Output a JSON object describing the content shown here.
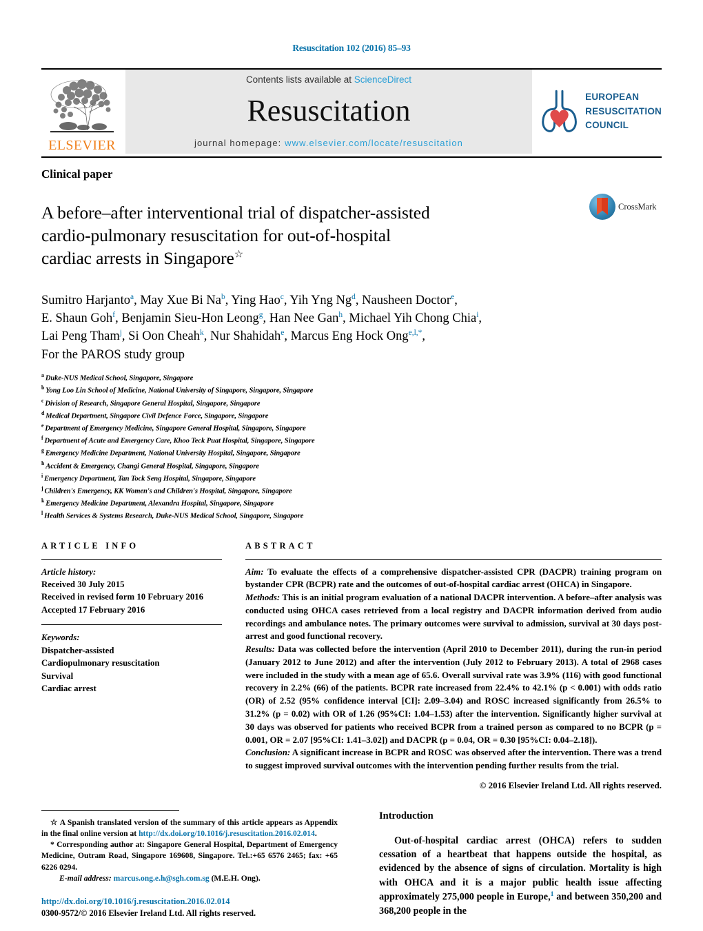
{
  "running_head": "Resuscitation 102 (2016) 85–93",
  "masthead": {
    "elsevier_wordmark": "ELSEVIER",
    "contents_prefix": "Contents lists available at ",
    "contents_link": "ScienceDirect",
    "journal_name": "Resuscitation",
    "homepage_prefix": "journal homepage: ",
    "homepage_url": "www.elsevier.com/locate/resuscitation",
    "erc_lines": [
      "EUROPEAN",
      "RESUSCITATION",
      "COUNCIL"
    ],
    "colors": {
      "elsevier_orange": "#F07F1A",
      "link_blue": "#2a9fd6",
      "erc_blue": "#1a5e8f",
      "erc_heart_red": "#e04a4a",
      "band_grey": "#e8e8e8"
    }
  },
  "section_type": "Clinical paper",
  "title": {
    "line1": "A before–after interventional trial of dispatcher-assisted",
    "line2": "cardio-pulmonary resuscitation for out-of-hospital",
    "line3": "cardiac arrests in Singapore",
    "star": "☆"
  },
  "crossmark": {
    "label": "CrossMark"
  },
  "authors": {
    "line1": [
      {
        "name": "Sumitro Harjanto",
        "sup": "a"
      },
      {
        "name": "May Xue Bi Na",
        "sup": "b"
      },
      {
        "name": "Ying Hao",
        "sup": "c"
      },
      {
        "name": "Yih Yng Ng",
        "sup": "d"
      },
      {
        "name": "Nausheen Doctor",
        "sup": "e"
      }
    ],
    "line2": [
      {
        "name": "E. Shaun Goh",
        "sup": "f"
      },
      {
        "name": "Benjamin Sieu-Hon Leong",
        "sup": "g"
      },
      {
        "name": "Han Nee Gan",
        "sup": "h"
      },
      {
        "name": "Michael Yih Chong Chia",
        "sup": "i"
      }
    ],
    "line3": [
      {
        "name": "Lai Peng Tham",
        "sup": "j"
      },
      {
        "name": "Si Oon Cheah",
        "sup": "k"
      },
      {
        "name": "Nur Shahidah",
        "sup": "e"
      },
      {
        "name": "Marcus Eng Hock Ong",
        "sup": "e,l,*"
      }
    ],
    "line4": "For the PAROS study group"
  },
  "affiliations": [
    {
      "mark": "a",
      "text": "Duke-NUS Medical School, Singapore, Singapore"
    },
    {
      "mark": "b",
      "text": "Yong Loo Lin School of Medicine, National University of Singapore, Singapore, Singapore"
    },
    {
      "mark": "c",
      "text": "Division of Research, Singapore General Hospital, Singapore, Singapore"
    },
    {
      "mark": "d",
      "text": "Medical Department, Singapore Civil Defence Force, Singapore, Singapore"
    },
    {
      "mark": "e",
      "text": "Department of Emergency Medicine, Singapore General Hospital, Singapore, Singapore"
    },
    {
      "mark": "f",
      "text": "Department of Acute and Emergency Care, Khoo Teck Puat Hospital, Singapore, Singapore"
    },
    {
      "mark": "g",
      "text": "Emergency Medicine Department, National University Hospital, Singapore, Singapore"
    },
    {
      "mark": "h",
      "text": "Accident & Emergency, Changi General Hospital, Singapore, Singapore"
    },
    {
      "mark": "i",
      "text": "Emergency Department, Tan Tock Seng Hospital, Singapore, Singapore"
    },
    {
      "mark": "j",
      "text": "Children's Emergency, KK Women's and Children's Hospital, Singapore, Singapore"
    },
    {
      "mark": "k",
      "text": "Emergency Medicine Department, Alexandra Hospital, Singapore, Singapore"
    },
    {
      "mark": "l",
      "text": "Health Services & Systems Research, Duke-NUS Medical School, Singapore, Singapore"
    }
  ],
  "article_info": {
    "heading": "ARTICLE INFO",
    "history_label": "Article history:",
    "history": [
      "Received 30 July 2015",
      "Received in revised form 10 February 2016",
      "Accepted 17 February 2016"
    ],
    "keywords_label": "Keywords:",
    "keywords": [
      "Dispatcher-assisted",
      "Cardiopulmonary resuscitation",
      "Survival",
      "Cardiac arrest"
    ]
  },
  "abstract": {
    "heading": "ABSTRACT",
    "aim_label": "Aim:",
    "aim_text": " To evaluate the effects of a comprehensive dispatcher-assisted CPR (DACPR) training program on bystander CPR (BCPR) rate and the outcomes of out-of-hospital cardiac arrest (OHCA) in Singapore.",
    "methods_label": "Methods:",
    "methods_text": " This is an initial program evaluation of a national DACPR intervention. A before–after analysis was conducted using OHCA cases retrieved from a local registry and DACPR information derived from audio recordings and ambulance notes. The primary outcomes were survival to admission, survival at 30 days post-arrest and good functional recovery.",
    "results_label": "Results:",
    "results_text": " Data was collected before the intervention (April 2010 to December 2011), during the run-in period (January 2012 to June 2012) and after the intervention (July 2012 to February 2013). A total of 2968 cases were included in the study with a mean age of 65.6. Overall survival rate was 3.9% (116) with good functional recovery in 2.2% (66) of the patients. BCPR rate increased from 22.4% to 42.1% (p < 0.001) with odds ratio (OR) of 2.52 (95% confidence interval [CI]: 2.09–3.04) and ROSC increased significantly from 26.5% to 31.2% (p = 0.02) with OR of 1.26 (95%CI: 1.04–1.53) after the intervention. Significantly higher survival at 30 days was observed for patients who received BCPR from a trained person as compared to no BCPR (p = 0.001, OR = 2.07 [95%CI: 1.41–3.02]) and DACPR (p = 0.04, OR = 0.30 [95%CI: 0.04–2.18]).",
    "conclusion_label": "Conclusion:",
    "conclusion_text": " A significant increase in BCPR and ROSC was observed after the intervention. There was a trend to suggest improved survival outcomes with the intervention pending further results from the trial.",
    "copyright": "© 2016 Elsevier Ireland Ltd. All rights reserved."
  },
  "footnotes": {
    "star_symbol": "☆",
    "star_text_1": " A Spanish translated version of the summary of this article appears as Appendix in the final online version at ",
    "star_link": "http://dx.doi.org/10.1016/j.resuscitation.2016.02.014",
    "star_text_2": ".",
    "corr_symbol": "*",
    "corr_text": " Corresponding author at: Singapore General Hospital, Department of Emergency Medicine, Outram Road, Singapore 169608, Singapore. Tel.:+65 6576 2465; fax: +65 6226 0294.",
    "email_label": "E-mail address:",
    "email_link": "marcus.ong.e.h@sgh.com.sg",
    "email_suffix": " (M.E.H. Ong).",
    "doi_url": "http://dx.doi.org/10.1016/j.resuscitation.2016.02.014",
    "issn_line": "0300-9572/© 2016 Elsevier Ireland Ltd. All rights reserved."
  },
  "introduction": {
    "heading": "Introduction",
    "paragraph_part1": "Out-of-hospital cardiac arrest (OHCA) refers to sudden cessation of a heartbeat that happens outside the hospital, as evidenced by the absence of signs of circulation. Mortality is high with OHCA and it is a major public health issue affecting approximately 275,000 people in Europe,",
    "ref1": "1",
    "paragraph_part2": " and between 350,200 and 368,200 people in the"
  }
}
